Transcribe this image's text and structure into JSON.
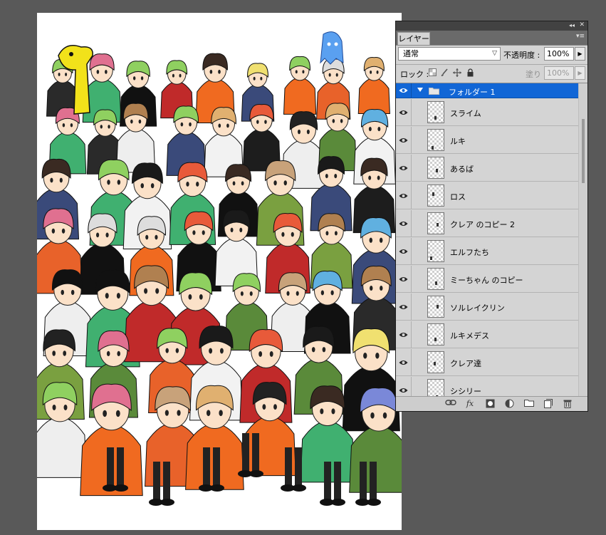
{
  "panel": {
    "tab_label": "レイヤー",
    "collapse_glyph": "◂◂",
    "close_glyph": "✕",
    "menu_glyph": "▾≡",
    "blend_mode": "通常",
    "opacity_label": "不透明度 :",
    "opacity_value": "100%",
    "lock_label": "ロック :",
    "fill_label": "塗り :",
    "fill_value": "100%"
  },
  "layers": [
    {
      "name": "フォルダー 1",
      "type": "folder",
      "selected": true
    },
    {
      "name": "スライム",
      "type": "layer"
    },
    {
      "name": "ルキ",
      "type": "layer"
    },
    {
      "name": "あるば",
      "type": "layer"
    },
    {
      "name": "ロス",
      "type": "layer"
    },
    {
      "name": "クレア のコピー 2",
      "type": "layer"
    },
    {
      "name": "エルフたち",
      "type": "layer"
    },
    {
      "name": "ミーちゃん のコピー",
      "type": "layer"
    },
    {
      "name": "ソルレイクリン",
      "type": "layer"
    },
    {
      "name": "ルキメデス",
      "type": "layer"
    },
    {
      "name": "クレア達",
      "type": "layer"
    },
    {
      "name": "シシリー",
      "type": "layer"
    }
  ],
  "icons": {
    "lock_transparent": "lock-transparent-icon",
    "lock_paint": "brush-icon",
    "lock_move": "move-icon",
    "lock_all": "padlock-icon",
    "link": "link-icon",
    "fx": "fx-icon",
    "mask": "mask-icon",
    "adjust": "adjustment-icon",
    "group": "folder-icon",
    "new": "new-layer-icon",
    "trash": "trash-icon"
  },
  "colors": {
    "selection": "#1166d6",
    "workspace": "#595959",
    "panel": "#d4d4d4"
  }
}
